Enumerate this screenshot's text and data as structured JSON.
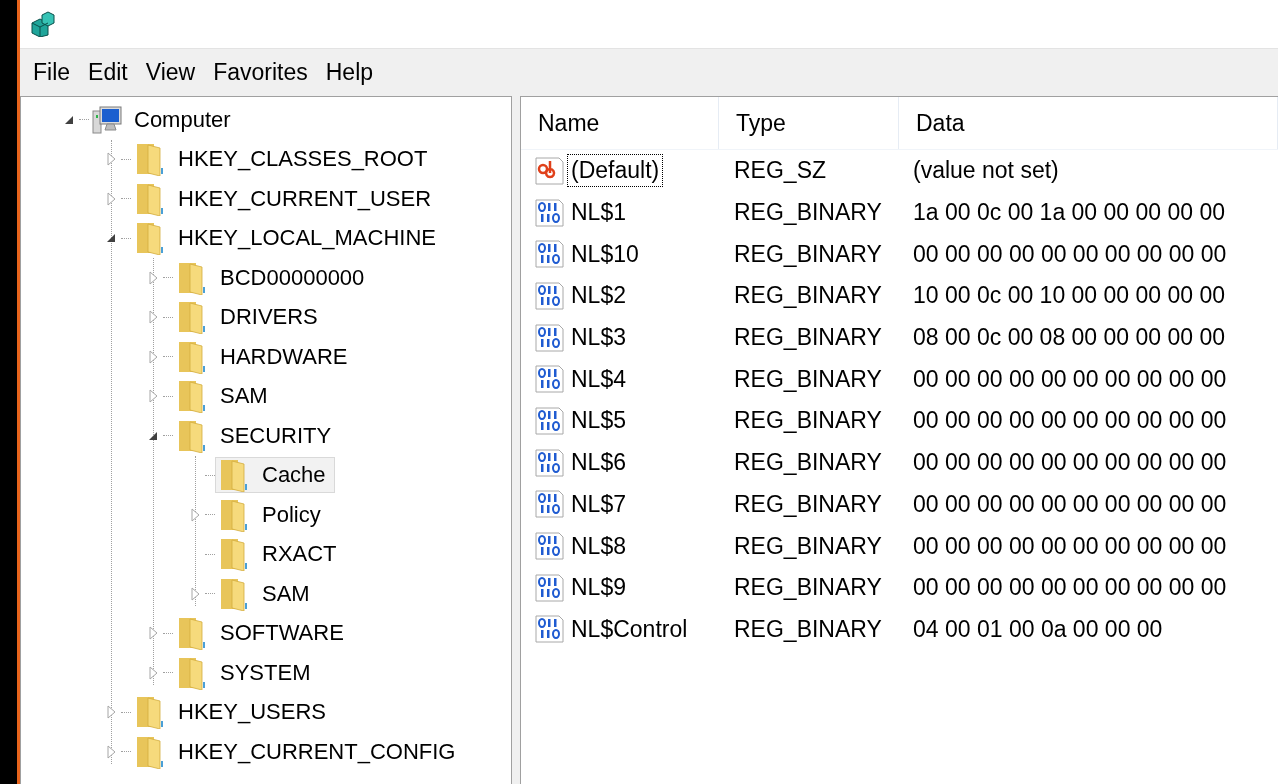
{
  "menu": [
    "File",
    "Edit",
    "View",
    "Favorites",
    "Help"
  ],
  "tree": [
    {
      "label": "Computer",
      "kind": "computer",
      "expandable": true,
      "expanded": true,
      "selected": false,
      "children": [
        {
          "label": "HKEY_CLASSES_ROOT",
          "kind": "folder",
          "expandable": true,
          "expanded": false,
          "selected": false
        },
        {
          "label": "HKEY_CURRENT_USER",
          "kind": "folder",
          "expandable": true,
          "expanded": false,
          "selected": false
        },
        {
          "label": "HKEY_LOCAL_MACHINE",
          "kind": "folder",
          "expandable": true,
          "expanded": true,
          "selected": false,
          "children": [
            {
              "label": "BCD00000000",
              "kind": "folder",
              "expandable": true,
              "expanded": false,
              "selected": false
            },
            {
              "label": "DRIVERS",
              "kind": "folder",
              "expandable": true,
              "expanded": false,
              "selected": false
            },
            {
              "label": "HARDWARE",
              "kind": "folder",
              "expandable": true,
              "expanded": false,
              "selected": false
            },
            {
              "label": "SAM",
              "kind": "folder",
              "expandable": true,
              "expanded": false,
              "selected": false
            },
            {
              "label": "SECURITY",
              "kind": "folder",
              "expandable": true,
              "expanded": true,
              "selected": false,
              "children": [
                {
                  "label": "Cache",
                  "kind": "folder",
                  "expandable": false,
                  "expanded": false,
                  "selected": true
                },
                {
                  "label": "Policy",
                  "kind": "folder",
                  "expandable": true,
                  "expanded": false,
                  "selected": false
                },
                {
                  "label": "RXACT",
                  "kind": "folder",
                  "expandable": false,
                  "expanded": false,
                  "selected": false
                },
                {
                  "label": "SAM",
                  "kind": "folder",
                  "expandable": true,
                  "expanded": false,
                  "selected": false
                }
              ]
            },
            {
              "label": "SOFTWARE",
              "kind": "folder",
              "expandable": true,
              "expanded": false,
              "selected": false
            },
            {
              "label": "SYSTEM",
              "kind": "folder",
              "expandable": true,
              "expanded": false,
              "selected": false
            }
          ]
        },
        {
          "label": "HKEY_USERS",
          "kind": "folder",
          "expandable": true,
          "expanded": false,
          "selected": false
        },
        {
          "label": "HKEY_CURRENT_CONFIG",
          "kind": "folder",
          "expandable": true,
          "expanded": false,
          "selected": false
        }
      ]
    }
  ],
  "table": {
    "columns": [
      "Name",
      "Type",
      "Data"
    ],
    "rows": [
      {
        "kind": "string",
        "name": "(Default)",
        "type": "REG_SZ",
        "data": "(value not set)",
        "focused": true
      },
      {
        "kind": "binary",
        "name": "NL$1",
        "type": "REG_BINARY",
        "data": "1a 00 0c 00 1a 00 00 00 00 00",
        "focused": false
      },
      {
        "kind": "binary",
        "name": "NL$10",
        "type": "REG_BINARY",
        "data": "00 00 00 00 00 00 00 00 00 00",
        "focused": false
      },
      {
        "kind": "binary",
        "name": "NL$2",
        "type": "REG_BINARY",
        "data": "10 00 0c 00 10 00 00 00 00 00",
        "focused": false
      },
      {
        "kind": "binary",
        "name": "NL$3",
        "type": "REG_BINARY",
        "data": "08 00 0c 00 08 00 00 00 00 00",
        "focused": false
      },
      {
        "kind": "binary",
        "name": "NL$4",
        "type": "REG_BINARY",
        "data": "00 00 00 00 00 00 00 00 00 00",
        "focused": false
      },
      {
        "kind": "binary",
        "name": "NL$5",
        "type": "REG_BINARY",
        "data": "00 00 00 00 00 00 00 00 00 00",
        "focused": false
      },
      {
        "kind": "binary",
        "name": "NL$6",
        "type": "REG_BINARY",
        "data": "00 00 00 00 00 00 00 00 00 00",
        "focused": false
      },
      {
        "kind": "binary",
        "name": "NL$7",
        "type": "REG_BINARY",
        "data": "00 00 00 00 00 00 00 00 00 00",
        "focused": false
      },
      {
        "kind": "binary",
        "name": "NL$8",
        "type": "REG_BINARY",
        "data": "00 00 00 00 00 00 00 00 00 00",
        "focused": false
      },
      {
        "kind": "binary",
        "name": "NL$9",
        "type": "REG_BINARY",
        "data": "00 00 00 00 00 00 00 00 00 00",
        "focused": false
      },
      {
        "kind": "binary",
        "name": "NL$Control",
        "type": "REG_BINARY",
        "data": "04 00 01 00 0a 00 00 00",
        "focused": false
      }
    ]
  }
}
